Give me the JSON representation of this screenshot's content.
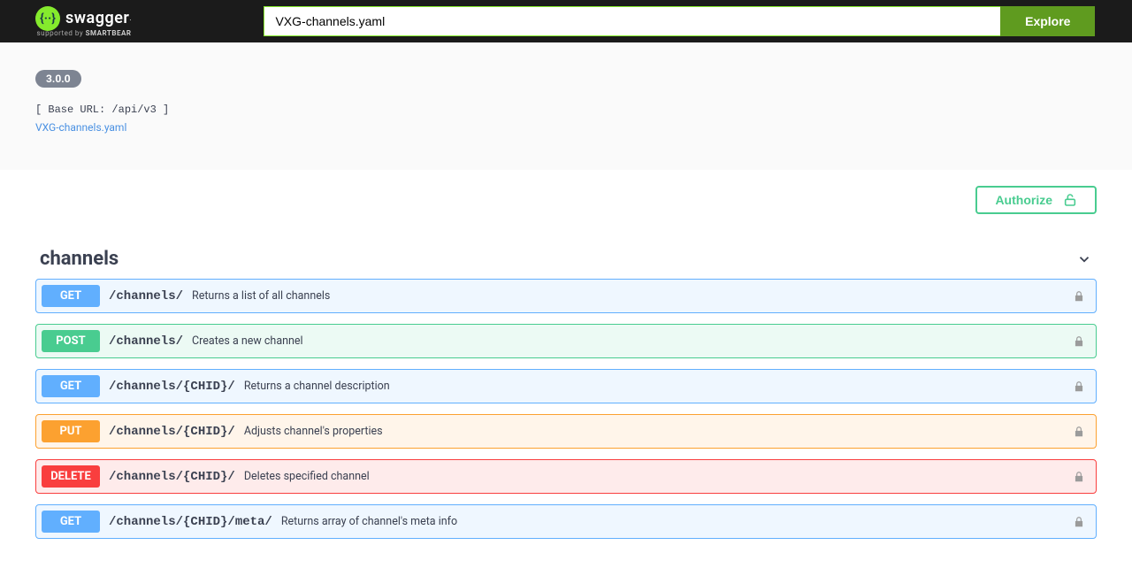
{
  "topbar": {
    "logo_brand": "swagger",
    "logo_sub_prefix": "supported by ",
    "logo_sub_brand": "SMARTBEAR",
    "url_value": "VXG-channels.yaml",
    "explore_label": "Explore"
  },
  "info": {
    "version": "3.0.0",
    "base_url_text": "[ Base URL: /api/v3 ]",
    "spec_link_text": "VXG-channels.yaml"
  },
  "auth": {
    "authorize_label": "Authorize"
  },
  "tag": {
    "name": "channels"
  },
  "operations": [
    {
      "method": "GET",
      "path": "/channels/",
      "summary": "Returns a list of all channels"
    },
    {
      "method": "POST",
      "path": "/channels/",
      "summary": "Creates a new channel"
    },
    {
      "method": "GET",
      "path": "/channels/{CHID}/",
      "summary": "Returns a channel description"
    },
    {
      "method": "PUT",
      "path": "/channels/{CHID}/",
      "summary": "Adjusts channel's properties"
    },
    {
      "method": "DELETE",
      "path": "/channels/{CHID}/",
      "summary": "Deletes specified channel"
    },
    {
      "method": "GET",
      "path": "/channels/{CHID}/meta/",
      "summary": "Returns array of channel's meta info"
    }
  ]
}
